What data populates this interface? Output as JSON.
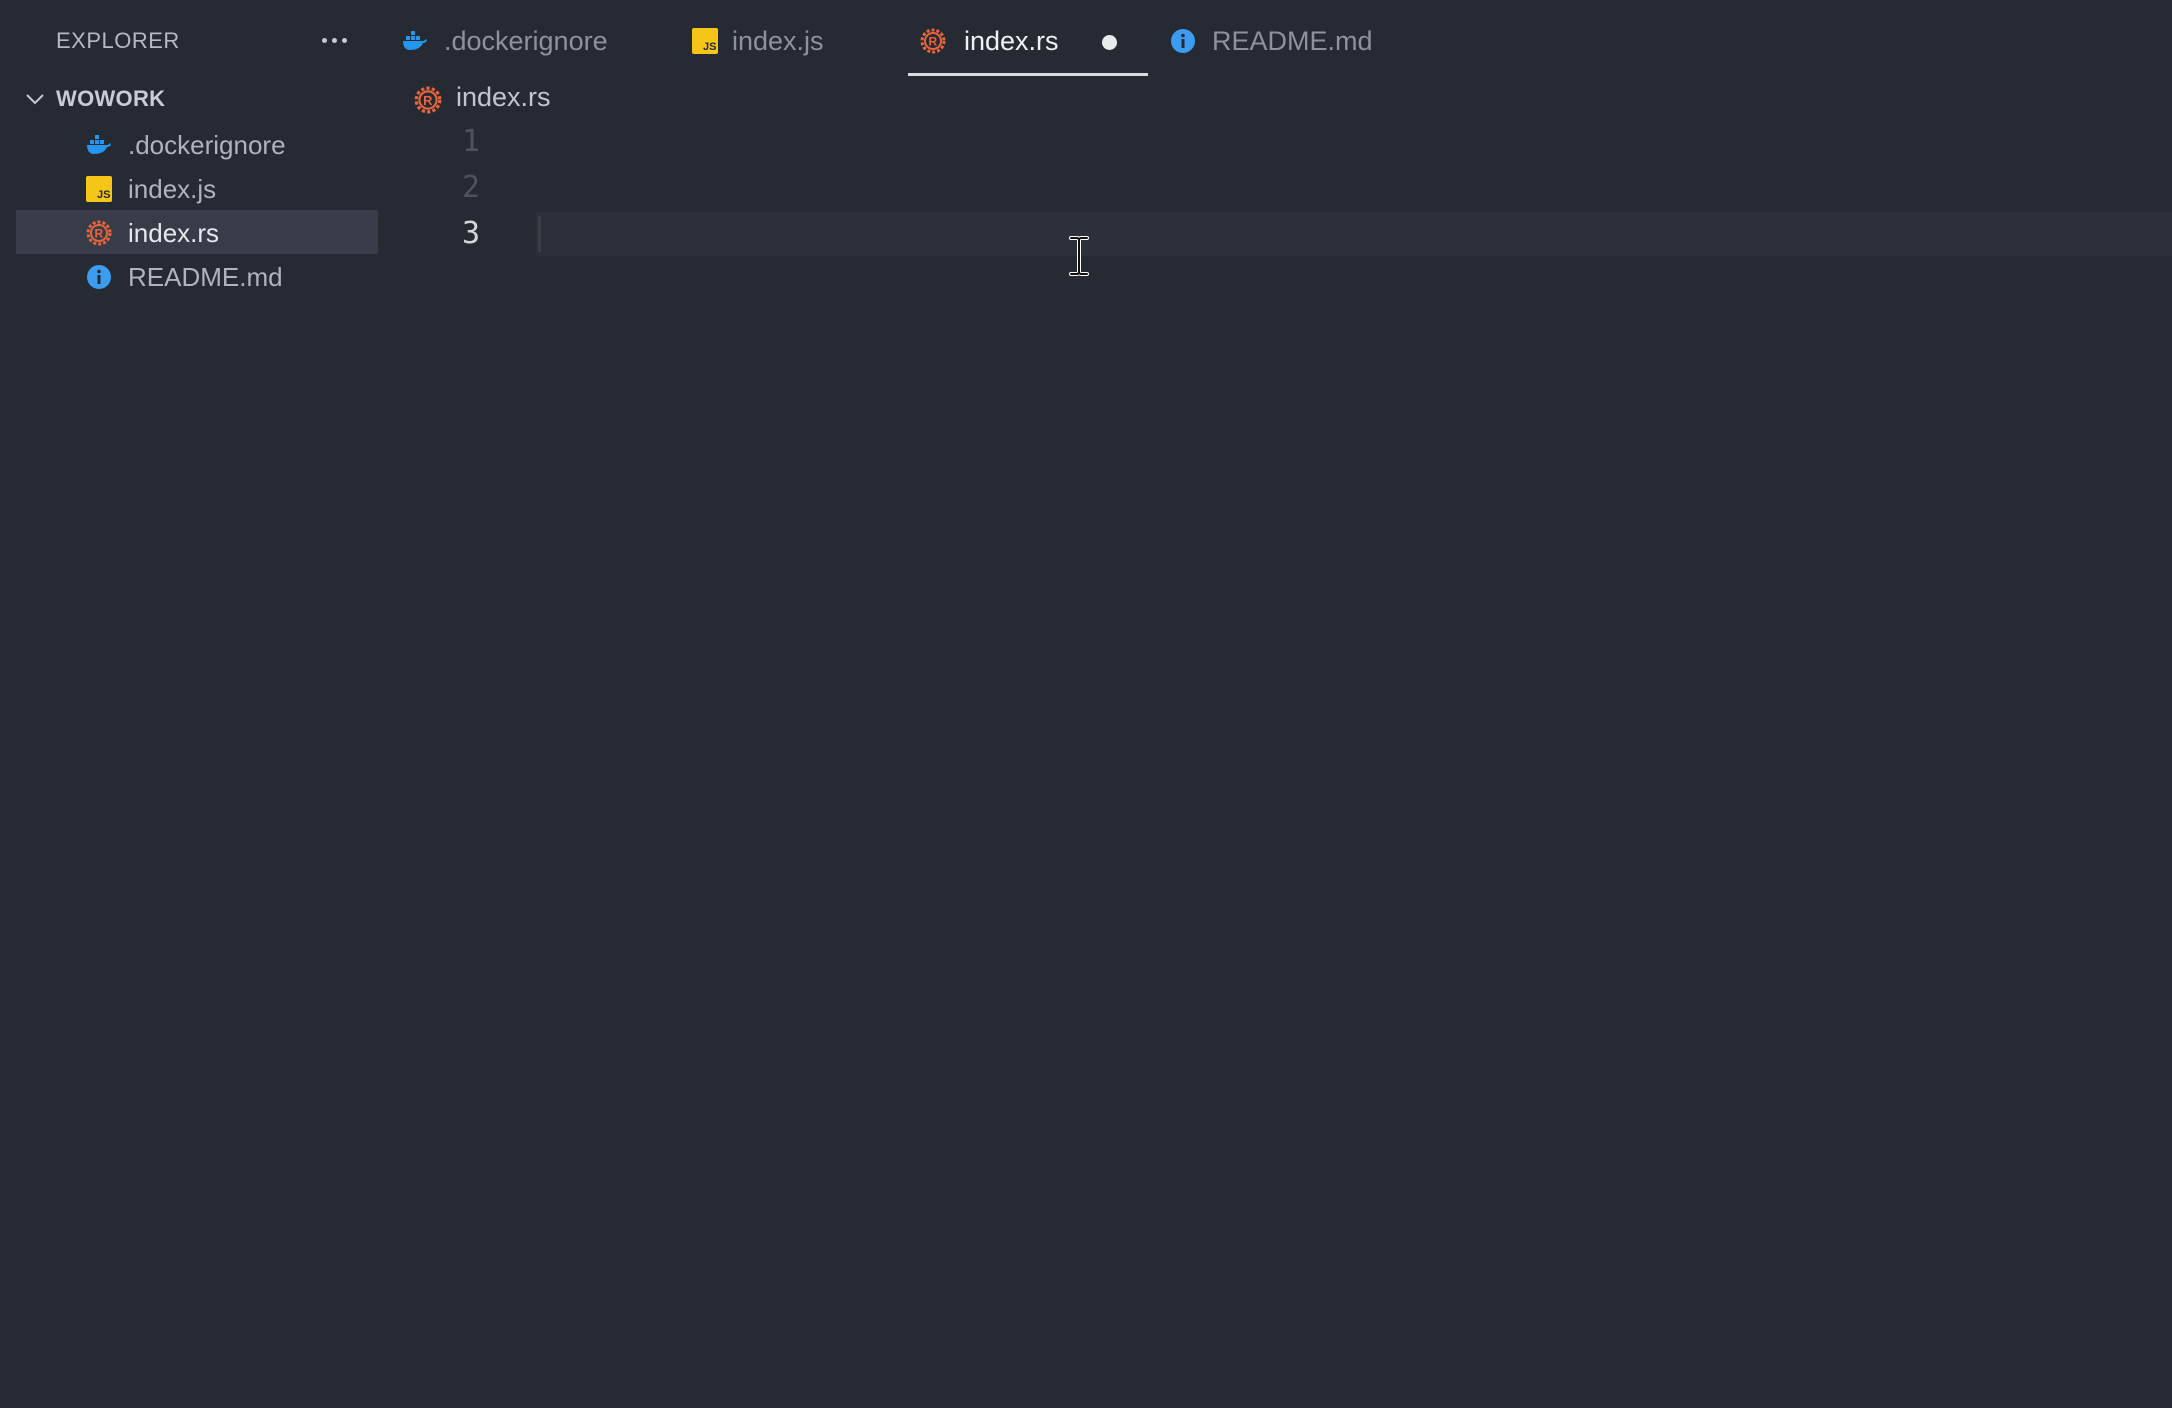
{
  "sidebar": {
    "title": "EXPLORER",
    "more_icon": "ellipsis-icon",
    "workspace": "WOWORK",
    "files": [
      {
        "name": ".dockerignore",
        "icon": "docker-icon"
      },
      {
        "name": "index.js",
        "icon": "javascript-icon"
      },
      {
        "name": "index.rs",
        "icon": "rust-icon",
        "selected": true
      },
      {
        "name": "README.md",
        "icon": "info-icon"
      }
    ]
  },
  "tabs": [
    {
      "label": ".dockerignore",
      "icon": "docker-icon"
    },
    {
      "label": "index.js",
      "icon": "javascript-icon"
    },
    {
      "label": "index.rs",
      "icon": "rust-icon",
      "active": true,
      "dirty": true
    },
    {
      "label": "README.md",
      "icon": "info-icon"
    }
  ],
  "breadcrumb": {
    "file": "index.rs",
    "icon": "rust-icon"
  },
  "editor": {
    "line_numbers": [
      "1",
      "2",
      "3"
    ],
    "current_line": 3
  },
  "colors": {
    "background": "#262a33",
    "docker": "#2496ed",
    "javascript": "#f5c518",
    "rust": "#e8643c",
    "info": "#3b9cf0",
    "selection": "#373c48"
  }
}
